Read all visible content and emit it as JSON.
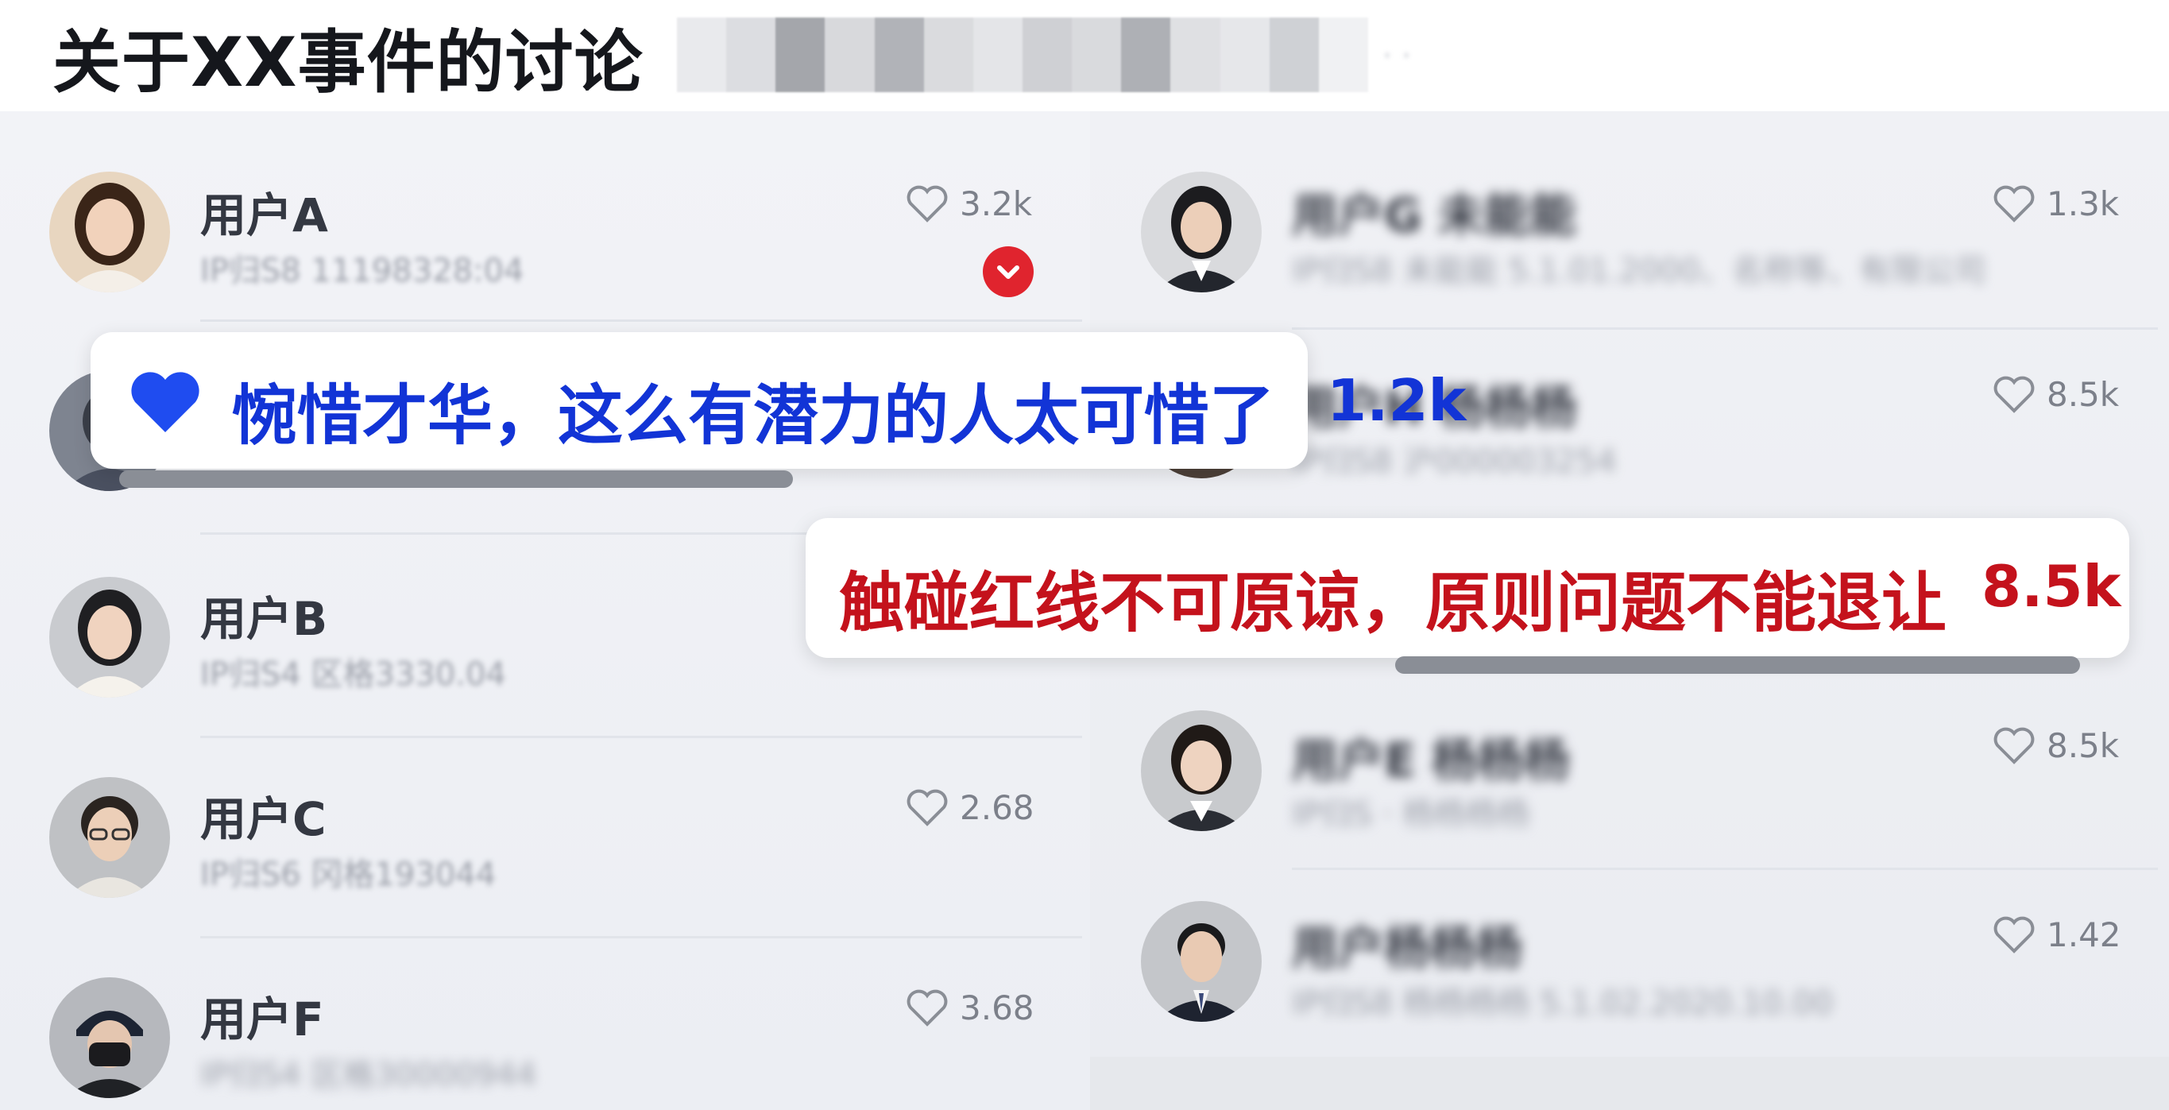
{
  "header": {
    "title": "关于XX事件的讨论",
    "redacted_suffix": "· ·"
  },
  "left_column": [
    {
      "name": "用户A",
      "meta": "IP归S8 11198328:04",
      "likes": "3.2k",
      "verified": true
    },
    {
      "name": "用户B",
      "meta": "IP归S4  区格3330.04",
      "likes": ""
    },
    {
      "name": "用户C",
      "meta": "IP归S6  冈格193044",
      "likes": "2.68"
    },
    {
      "name": "用户F",
      "meta": "IP归S4  区格30000944",
      "likes": "3.68"
    }
  ],
  "right_column": [
    {
      "name": "用户G  未能能",
      "meta": "IP归S8 未能能 5.1.01.2000、名称等、有限公司",
      "likes": "1.3k"
    },
    {
      "name": "用户H 杨杨杨",
      "meta": "IP归S8 沪000003254",
      "likes": "8.5k"
    },
    {
      "name": "用户E  杨杨杨",
      "meta": "IP归S · 杨杨杨杨",
      "likes": "8.5k"
    },
    {
      "name": "用户杨杨杨",
      "meta": "IP归S8 杨杨杨杨 5.1.02.2020.10.00",
      "likes": "1.42"
    }
  ],
  "callouts": [
    {
      "text": "惋惜才华，这么有潜力的人太可惜了",
      "count": "1.2k",
      "color": "#1234d6"
    },
    {
      "text": "触碰红线不可原谅，原则问题不能退让",
      "count": "8.5k",
      "color": "#c4121c"
    }
  ],
  "icons": {
    "like": "heart-outline-icon",
    "callout_like": "heart-filled-icon",
    "verified": "check-badge-icon"
  }
}
